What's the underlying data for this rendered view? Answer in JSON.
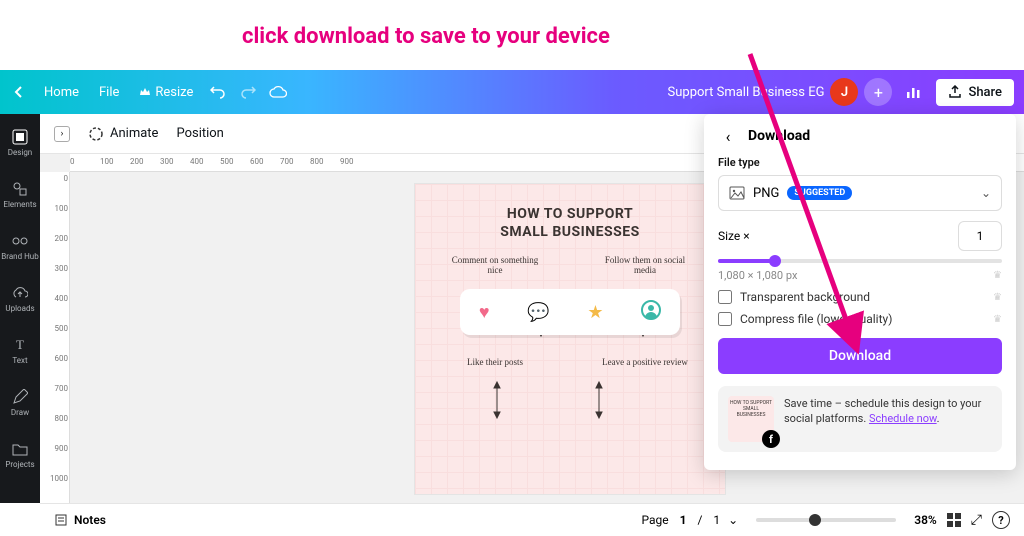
{
  "annotation": "click download to save to your device",
  "header": {
    "home": "Home",
    "file": "File",
    "resize": "Resize",
    "title": "Support Small Business EG",
    "avatarInitial": "J",
    "share": "Share"
  },
  "subtoolbar": {
    "animate": "Animate",
    "position": "Position"
  },
  "sidebar": {
    "items": [
      {
        "label": "Design"
      },
      {
        "label": "Elements"
      },
      {
        "label": "Brand Hub"
      },
      {
        "label": "Uploads"
      },
      {
        "label": "Text"
      },
      {
        "label": "Draw"
      },
      {
        "label": "Projects"
      }
    ]
  },
  "rulerTop": [
    "0",
    "100",
    "200",
    "300",
    "400",
    "500",
    "600",
    "700",
    "800",
    "900"
  ],
  "rulerLeft": [
    "0",
    "100",
    "200",
    "300",
    "400",
    "500",
    "600",
    "700",
    "800",
    "900",
    "1000"
  ],
  "design": {
    "titleLine1": "HOW TO SUPPORT",
    "titleLine2": "SMALL BUSINESSES",
    "top1": "Comment on something nice",
    "top2": "Follow them on social media",
    "bottom1": "Like their posts",
    "bottom2": "Leave a positive review"
  },
  "downloadPanel": {
    "title": "Download",
    "fileTypeLabel": "File type",
    "fileType": "PNG",
    "suggested": "SUGGESTED",
    "sizeLabel": "Size ×",
    "sizeValue": "1",
    "dimensions": "1,080 × 1,080 px",
    "opt1": "Transparent background",
    "opt2": "Compress file (lower quality)",
    "button": "Download",
    "promo": "Save time – schedule this design to your social platforms. ",
    "promoLink": "Schedule now",
    "thumbTitle": "HOW TO SUPPORT SMALL BUSINESSES"
  },
  "footer": {
    "notes": "Notes",
    "pageLabel": "Page",
    "pageCurrent": "1",
    "pageSep": "/",
    "pageTotal": "1",
    "zoom": "38%"
  }
}
